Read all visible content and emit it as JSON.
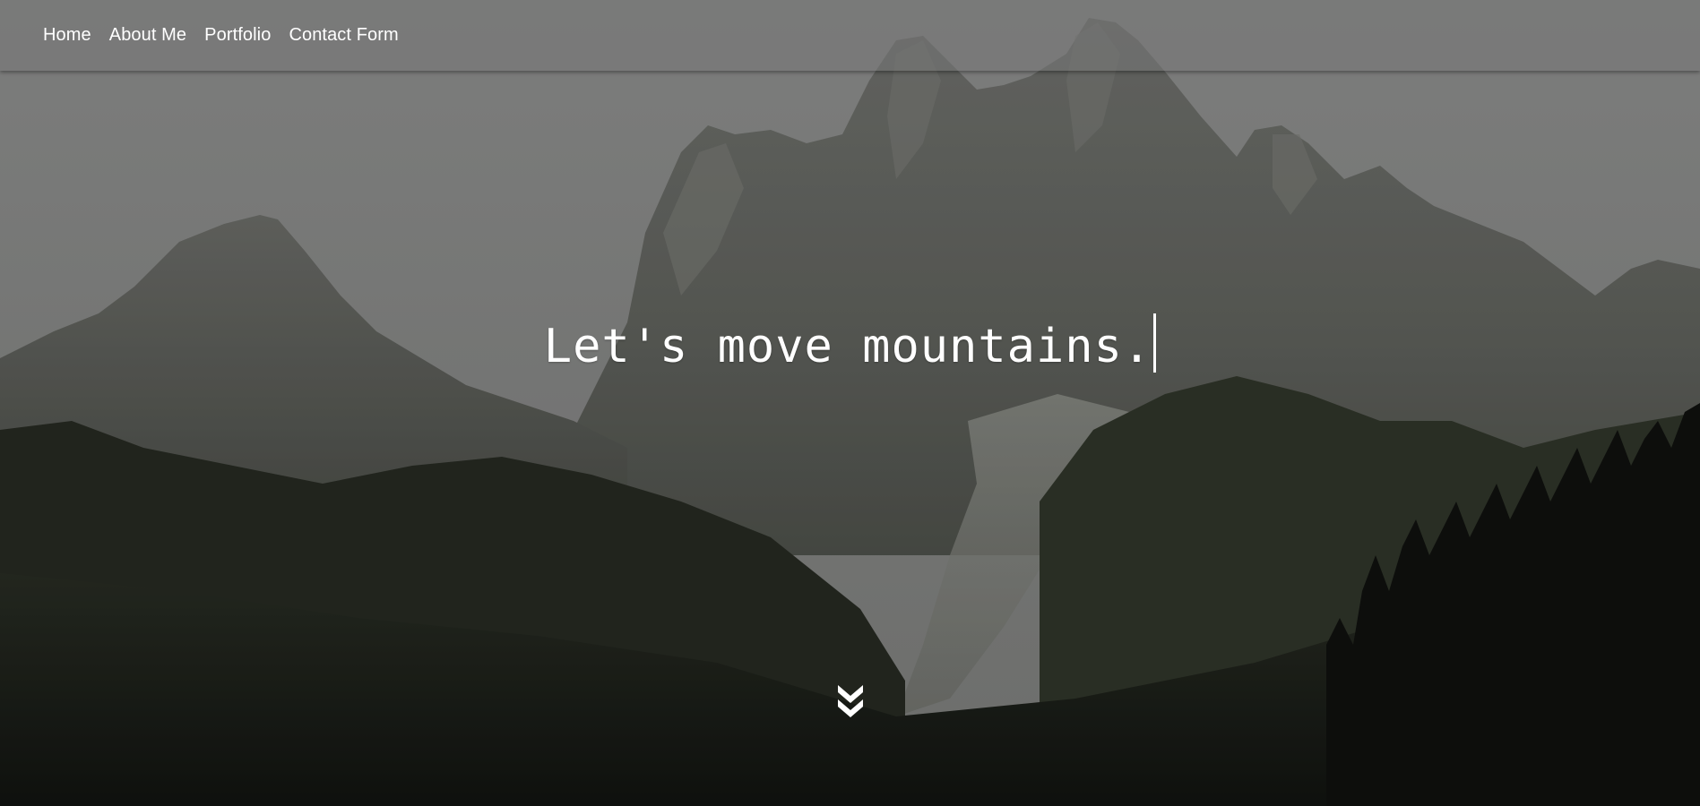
{
  "nav": {
    "items": [
      {
        "label": "Home"
      },
      {
        "label": "About Me"
      },
      {
        "label": "Portfolio"
      },
      {
        "label": "Contact Form"
      }
    ]
  },
  "hero": {
    "headline": "Let's move mountains.",
    "background": "mountain-landscape",
    "scroll_icon": "double-chevron-down-icon"
  },
  "colors": {
    "nav_bg": "#7a7b7a",
    "text": "#ffffff",
    "sky": "#8a8b8a",
    "rock": "#6f706c",
    "forest": "#1b1e18"
  }
}
